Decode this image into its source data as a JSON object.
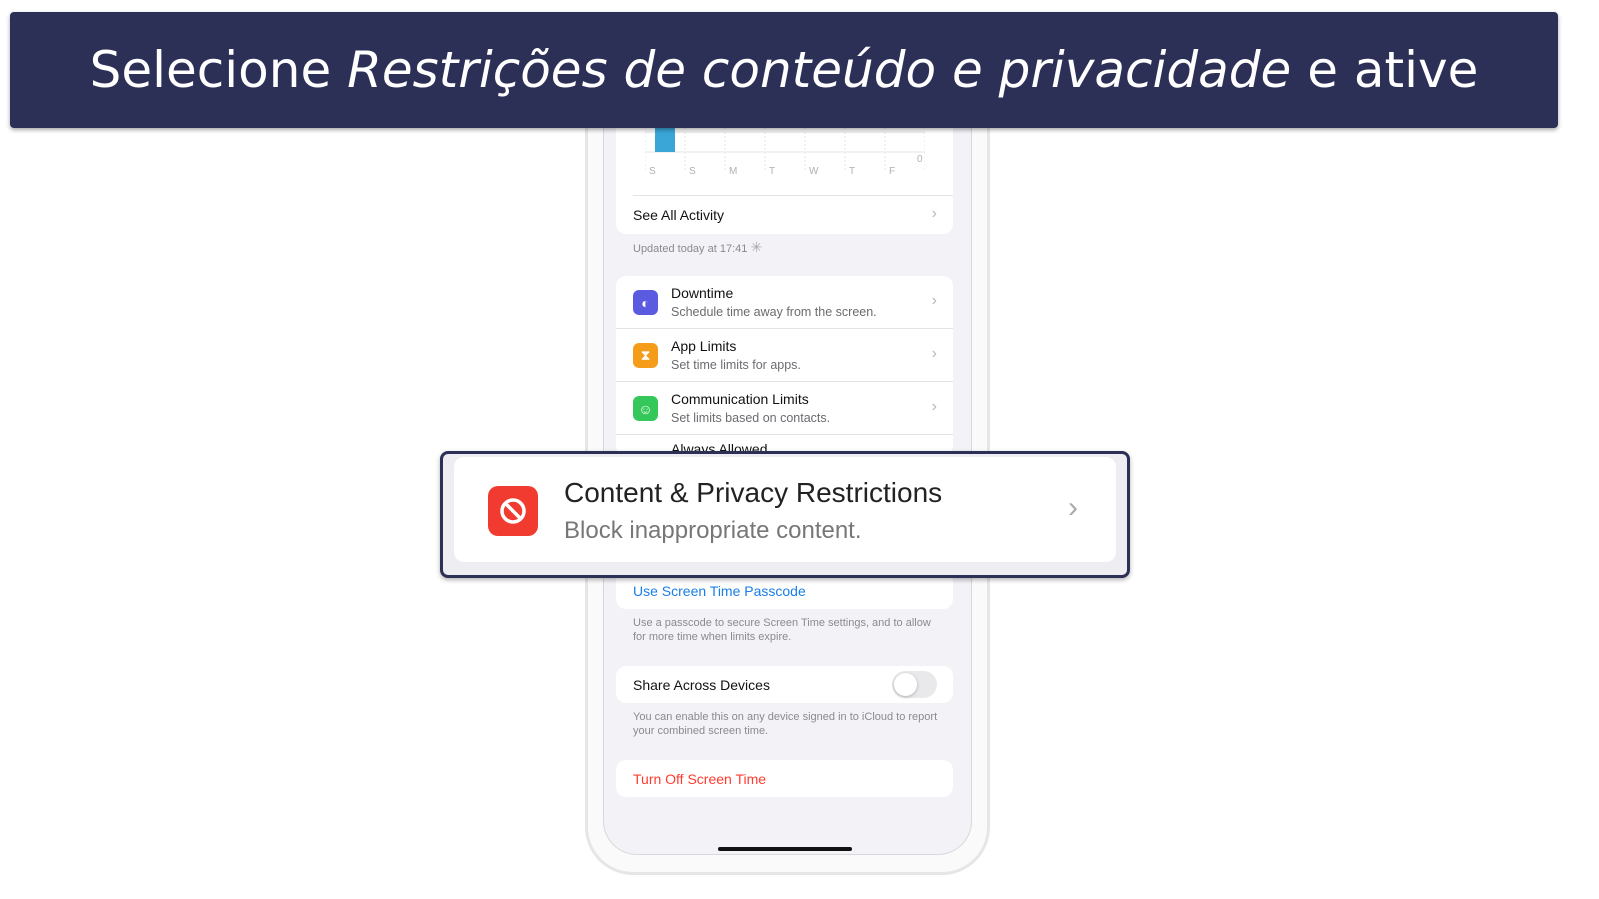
{
  "banner": {
    "prefix": "Selecione ",
    "italic": "Restrições de conteúdo e privacidade",
    "suffix": " e ative"
  },
  "chart": {
    "days": [
      "S",
      "S",
      "M",
      "T",
      "W",
      "T",
      "F"
    ],
    "zero_label": "0",
    "bar_color": "#3aa6d8"
  },
  "activity": {
    "see_all": "See All Activity",
    "updated": "Updated today at 17:41"
  },
  "items": [
    {
      "title": "Downtime",
      "subtitle": "Schedule time away from the screen.",
      "color": "#5a5be0",
      "icon": "moon-clock-icon"
    },
    {
      "title": "App Limits",
      "subtitle": "Set time limits for apps.",
      "color": "#f59d1a",
      "icon": "hourglass-icon"
    },
    {
      "title": "Communication Limits",
      "subtitle": "Set limits based on contacts.",
      "color": "#34c759",
      "icon": "person-circle-icon"
    },
    {
      "title": "Always Allowed"
    }
  ],
  "callout": {
    "title": "Content & Privacy Restrictions",
    "subtitle": "Block inappropriate content.",
    "color": "#f23b30",
    "icon": "no-entry-icon"
  },
  "passcode": {
    "label": "Use Screen Time Passcode",
    "footer": "Use a passcode to secure Screen Time settings, and to allow for more time when limits expire."
  },
  "share": {
    "label": "Share Across Devices",
    "enabled": false,
    "footer": "You can enable this on any device signed in to iCloud to report your combined screen time."
  },
  "turn_off": {
    "label": "Turn Off Screen Time",
    "color": "#ff3b30"
  }
}
